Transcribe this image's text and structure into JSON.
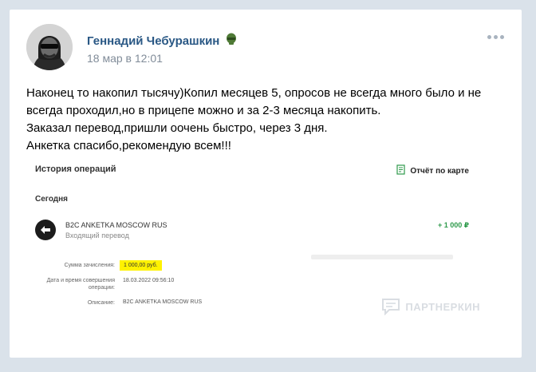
{
  "post": {
    "author": "Геннадий Чебурашкин",
    "date": "18 мар в 12:01",
    "text_lines": [
      "Наконец то накопил тысячу)Копил месяцев 5, опросов не всегда много было и не",
      "всегда проходил,но в прицепе можно и за 2-3 месяца накопить.",
      "Заказал перевод,пришли оочень быстро, через 3 дня.",
      "Анкетка спасибо,рекомендую всем!!!"
    ]
  },
  "screenshot": {
    "title": "История операций",
    "report_label": "Отчёт по карте",
    "section": "Сегодня",
    "tx_name": "B2C ANKETKA MOSCOW RUS",
    "tx_type": "Входящий перевод",
    "tx_amount": "+ 1 000 ₽",
    "sum_label": "Сумма зачисления:",
    "sum_value": "1 000,00 руб.",
    "datetime_label": "Дата и время совершения операции:",
    "datetime_value": "18.03.2022 09:56:10",
    "desc_label": "Описание:",
    "desc_value": "B2C ANKETKA MOSCOW RUS"
  },
  "watermark": "ПАРТНЕРКИН",
  "icons": {
    "more": "more-dots-icon",
    "badge": "helmet-badge-icon",
    "report": "report-document-icon",
    "transfer": "arrow-left-icon"
  }
}
